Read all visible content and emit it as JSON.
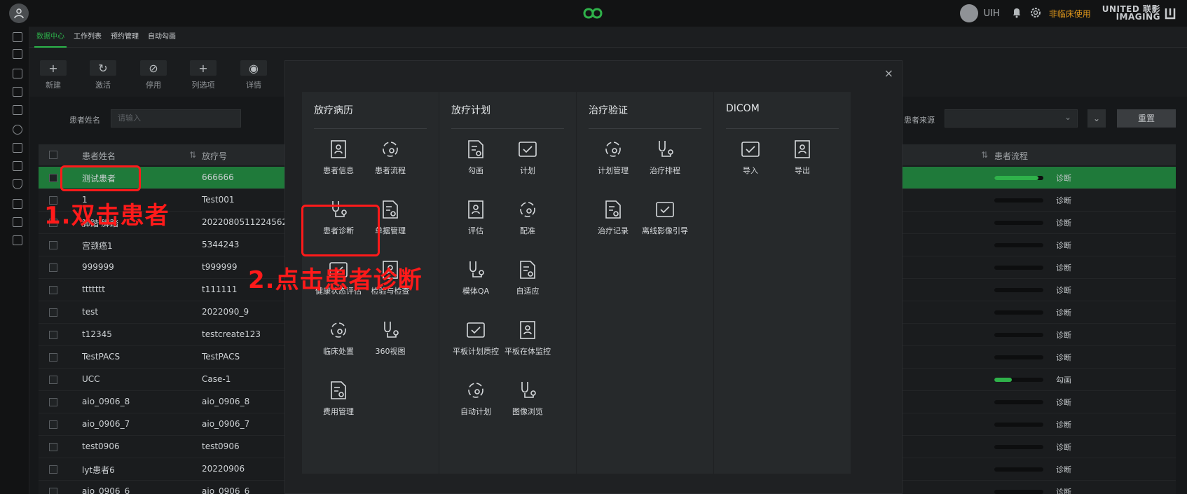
{
  "header": {
    "user_name": "UIH",
    "nonclinical_label": "非临床使用",
    "brand_line1": "UNITED 联影",
    "brand_line2": "IMAGING"
  },
  "tabs": [
    {
      "label": "数据中心",
      "active": true
    },
    {
      "label": "工作列表",
      "active": false
    },
    {
      "label": "预约管理",
      "active": false
    },
    {
      "label": "自动勾画",
      "active": false
    }
  ],
  "toolbar": {
    "new_label": "新建",
    "activate_label": "激活",
    "disable_label": "停用",
    "column_label": "列选项",
    "detail_label": "详情"
  },
  "filter": {
    "name_label": "患者姓名",
    "name_placeholder": "请输入",
    "source_label": "患者来源",
    "expand_icon": "chevron-double-down-icon",
    "reset_label": "重置"
  },
  "table": {
    "col_name": "患者姓名",
    "col_id": "放疗号",
    "col_flow": "患者流程",
    "rows": [
      {
        "name": "测试患者",
        "id": "666666",
        "status": "诊断",
        "progress": 0.9,
        "selected": true
      },
      {
        "name": "1",
        "id": "Test001",
        "status": "诊断",
        "progress": 0,
        "selected": false
      },
      {
        "name": "脚踏 脚踏",
        "id": "2022080511224562",
        "status": "诊断",
        "progress": 0,
        "selected": false
      },
      {
        "name": "宫颈癌1",
        "id": "5344243",
        "status": "诊断",
        "progress": 0,
        "selected": false
      },
      {
        "name": "999999",
        "id": "t999999",
        "status": "诊断",
        "progress": 0,
        "selected": false
      },
      {
        "name": "ttttttt",
        "id": "t111111",
        "status": "诊断",
        "progress": 0,
        "selected": false
      },
      {
        "name": "test",
        "id": "2022090_9",
        "status": "诊断",
        "progress": 0,
        "selected": false
      },
      {
        "name": "t12345",
        "id": "testcreate123",
        "status": "诊断",
        "progress": 0,
        "selected": false
      },
      {
        "name": "TestPACS",
        "id": "TestPACS",
        "status": "诊断",
        "progress": 0,
        "selected": false
      },
      {
        "name": "UCC",
        "id": "Case-1",
        "status": "勾画",
        "progress": 0.35,
        "selected": false
      },
      {
        "name": "aio_0906_8",
        "id": "aio_0906_8",
        "status": "诊断",
        "progress": 0,
        "selected": false
      },
      {
        "name": "aio_0906_7",
        "id": "aio_0906_7",
        "status": "诊断",
        "progress": 0,
        "selected": false
      },
      {
        "name": "test0906",
        "id": "test0906",
        "status": "诊断",
        "progress": 0,
        "selected": false
      },
      {
        "name": "lyt患者6",
        "id": "20220906",
        "status": "诊断",
        "progress": 0,
        "selected": false
      },
      {
        "name": "aio_0906_6",
        "id": "aio_0906_6",
        "status": "诊断",
        "progress": 0,
        "selected": false
      }
    ]
  },
  "menu": {
    "panels": [
      {
        "title": "放疗病历",
        "items": [
          "患者信息",
          "患者流程",
          "患者诊断",
          "单据管理",
          "健康状态评估",
          "检验与检查",
          "临床处置",
          "360视图",
          "费用管理"
        ]
      },
      {
        "title": "放疗计划",
        "items": [
          "勾画",
          "计划",
          "评估",
          "配准",
          "模体QA",
          "自适应",
          "平板计划质控",
          "平板在体监控",
          "自动计划",
          "图像浏览"
        ]
      },
      {
        "title": "治疗验证",
        "items": [
          "计划管理",
          "治疗排程",
          "治疗记录",
          "离线影像引导"
        ]
      },
      {
        "title": "DICOM",
        "items": [
          "导入",
          "导出"
        ]
      }
    ]
  },
  "annotations": {
    "step1": "1.双击患者",
    "step2": "2.点击患者诊断"
  },
  "colors": {
    "accent": "#2db44b",
    "annotation": "#ff1a1a",
    "warning": "#e49a1b"
  }
}
